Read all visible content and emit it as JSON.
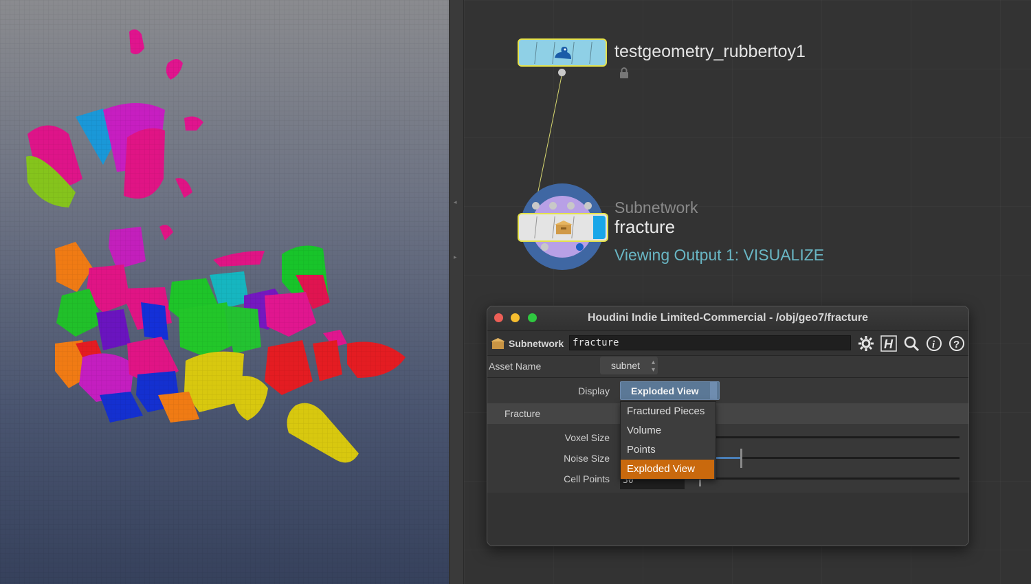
{
  "network": {
    "node1": {
      "name": "testgeometry_rubbertoy1",
      "color": "#8fd0e6"
    },
    "node2": {
      "type": "Subnetwork",
      "name": "fracture",
      "viewing": "Viewing Output 1: VISUALIZE"
    }
  },
  "dialog": {
    "title": "Houdini Indie Limited-Commercial - /obj/geo7/fracture",
    "toolbar": {
      "node_type": "Subnetwork",
      "node_name": "fracture",
      "icons": [
        "gear-icon",
        "houdini-h-icon",
        "search-icon",
        "info-icon",
        "help-icon"
      ]
    },
    "asset_name_label": "Asset Name",
    "asset_name_value": "subnet",
    "display_label": "Display",
    "display_value": "Exploded View",
    "folder_label": "Fracture",
    "params": {
      "voxel_size_label": "Voxel Size",
      "noise_size_label": "Noise Size",
      "cell_points_label": "Cell Points",
      "cell_points_value": "30"
    },
    "dropdown_options": [
      "Fractured Pieces",
      "Volume",
      "Points",
      "Exploded View"
    ],
    "dropdown_selected": "Exploded View"
  },
  "colors": {
    "accent_selected": "#c9690d",
    "node_border_selected": "#e5e24a",
    "viewing_text": "#69b6c4"
  }
}
